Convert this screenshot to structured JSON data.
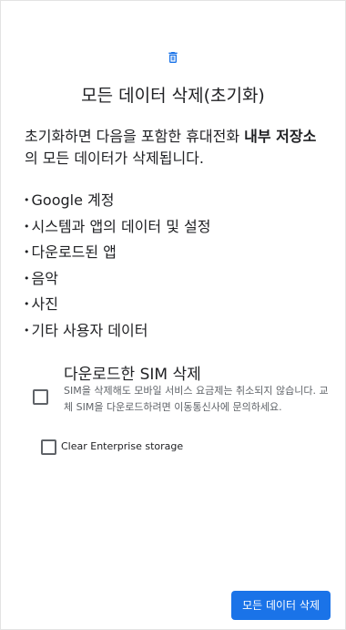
{
  "header": {
    "icon": "trash-icon",
    "title": "모든 데이터 삭제(초기화)"
  },
  "intro": {
    "prefix": "초기화하면 다음을 포함한 휴대전화 ",
    "bold": "내부 저장소",
    "suffix": "의 모든 데이터가 삭제됩니다."
  },
  "items": [
    "Google 계정",
    "시스템과 앱의 데이터 및 설정",
    "다운로드된 앱",
    "음악",
    "사진",
    "기타 사용자 데이터"
  ],
  "esim": {
    "title": "다운로드한 SIM 삭제",
    "description": "SIM을 삭제해도 모바일 서비스 요금제는 취소되지 않습니다. 교체 SIM을 다운로드하려면 이동통신사에 문의하세요.",
    "checked": false
  },
  "enterprise": {
    "label": "Clear Enterprise storage",
    "checked": false
  },
  "actions": {
    "erase_label": "모든 데이터 삭제"
  },
  "colors": {
    "accent": "#1a73e8"
  }
}
